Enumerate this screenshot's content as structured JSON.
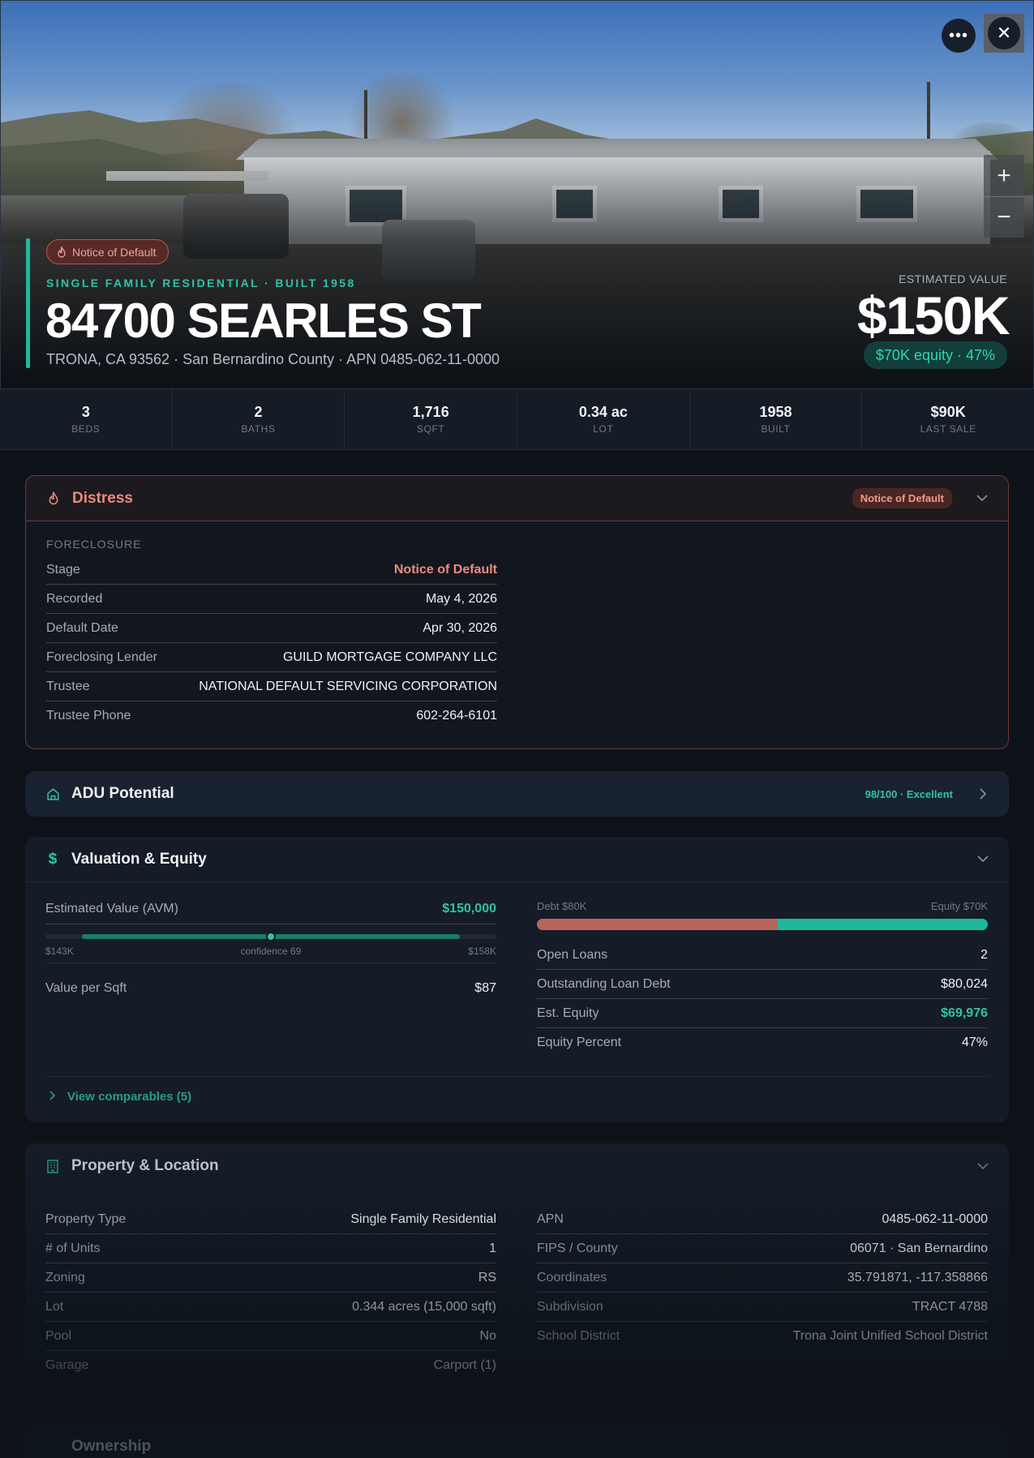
{
  "hero": {
    "badge": "Notice of Default",
    "kicker": "SINGLE FAMILY RESIDENTIAL · BUILT 1958",
    "address": "84700 SEARLES ST",
    "subline": "TRONA, CA 93562 · San Bernardino County · APN 0485-062-11-0000",
    "est_label": "ESTIMATED VALUE",
    "est_value": "$150K",
    "equity_pill": "$70K equity · 47%",
    "more_icon": "more-horizontal-icon",
    "close_icon": "close-icon",
    "zoom_in": "+",
    "zoom_out": "−"
  },
  "stats": [
    {
      "value": "3",
      "label": "BEDS"
    },
    {
      "value": "2",
      "label": "BATHS"
    },
    {
      "value": "1,716",
      "label": "SQFT"
    },
    {
      "value": "0.34 ac",
      "label": "LOT"
    },
    {
      "value": "1958",
      "label": "BUILT"
    },
    {
      "value": "$90K",
      "label": "LAST SALE"
    }
  ],
  "distress": {
    "title": "Distress",
    "badge": "Notice of Default",
    "section_label": "FORECLOSURE",
    "rows": [
      {
        "k": "Stage",
        "v": "Notice of Default"
      },
      {
        "k": "Recorded",
        "v": "May 4, 2026"
      },
      {
        "k": "Default Date",
        "v": "Apr 30, 2026"
      },
      {
        "k": "Foreclosing Lender",
        "v": "GUILD MORTGAGE COMPANY LLC"
      },
      {
        "k": "Trustee",
        "v": "NATIONAL DEFAULT SERVICING CORPORATION"
      },
      {
        "k": "Trustee Phone",
        "v": "602-264-6101"
      }
    ]
  },
  "adu": {
    "title": "ADU Potential",
    "score": "98/100 · Excellent"
  },
  "valuation": {
    "title": "Valuation & Equity",
    "avm_label": "Estimated Value (AVM)",
    "avm_value": "$150,000",
    "range_low": "$143K",
    "range_high": "$158K",
    "confidence": "confidence 69",
    "range_fill_percent": 100,
    "marker_percent": 50,
    "vps_label": "Value per Sqft",
    "vps_value": "$87",
    "debt_label": "Debt $80K",
    "equity_label": "Equity $70K",
    "debt_fraction": 0.534,
    "rows": [
      {
        "k": "Open Loans",
        "v": "2"
      },
      {
        "k": "Outstanding Loan Debt",
        "v": "$80,024"
      },
      {
        "k": "Est. Equity",
        "v": "$69,976"
      },
      {
        "k": "Equity Percent",
        "v": "47%"
      }
    ],
    "comparables": "View comparables (5)"
  },
  "property": {
    "title": "Property & Location",
    "left": [
      {
        "k": "Property Type",
        "v": "Single Family Residential"
      },
      {
        "k": "# of Units",
        "v": "1"
      },
      {
        "k": "Zoning",
        "v": "RS"
      },
      {
        "k": "Lot",
        "v": "0.344 acres (15,000 sqft)"
      },
      {
        "k": "Pool",
        "v": "No"
      },
      {
        "k": "Garage",
        "v": "Carport (1)"
      }
    ],
    "right": [
      {
        "k": "APN",
        "v": "0485-062-11-0000"
      },
      {
        "k": "FIPS / County",
        "v": "06071 · San Bernardino"
      },
      {
        "k": "Coordinates",
        "v": "35.791871, -117.358866"
      },
      {
        "k": "Subdivision",
        "v": "TRACT 4788"
      },
      {
        "k": "School District",
        "v": "Trona Joint Unified School District"
      }
    ]
  },
  "ownership": {
    "title": "Ownership"
  },
  "colors": {
    "accent": "#2fc3a4",
    "distress": "#ec8a7c",
    "debt": "#b9655c",
    "equity": "#1fb89d"
  }
}
